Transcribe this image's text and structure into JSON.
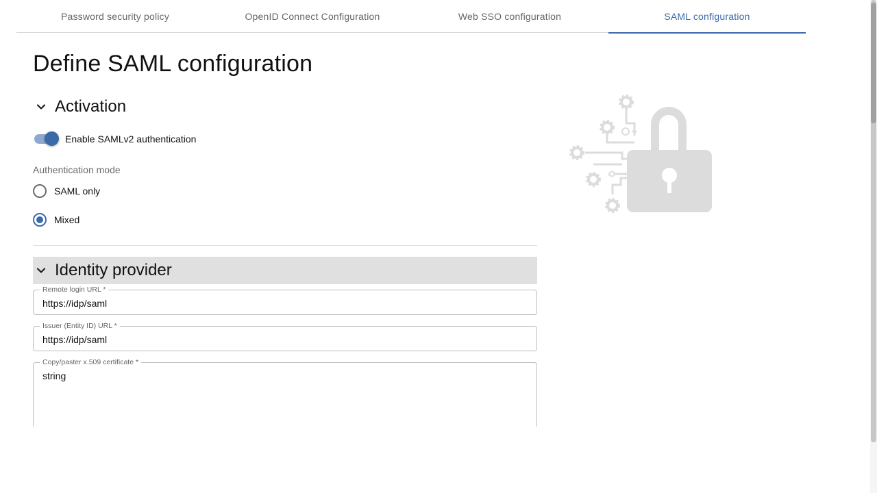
{
  "tabs": [
    {
      "label": "Password security policy"
    },
    {
      "label": "OpenID Connect Configuration"
    },
    {
      "label": "Web SSO configuration"
    },
    {
      "label": "SAML configuration"
    }
  ],
  "active_tab": "SAML configuration",
  "page_title": "Define SAML configuration",
  "activation": {
    "title": "Activation",
    "toggle_label": "Enable SAMLv2 authentication",
    "toggle_enabled": true,
    "auth_mode_label": "Authentication mode",
    "options": [
      {
        "label": "SAML only",
        "checked": false
      },
      {
        "label": "Mixed",
        "checked": true
      }
    ]
  },
  "identity_provider": {
    "title": "Identity provider",
    "fields": [
      {
        "label": "Remote login URL *",
        "value": "https://idp/saml"
      },
      {
        "label": "Issuer (Entity ID) URL *",
        "value": "https://idp/saml"
      },
      {
        "label": "Copy/paster x.509 certificate *",
        "value": "string"
      }
    ]
  },
  "icons": {
    "chevron": "chevron-down-icon",
    "illustration": "lock-gears-illustration"
  },
  "colors": {
    "accent": "#3b6aa8",
    "section_bg": "#e0e0e0",
    "illustration": "#dcdcdc"
  }
}
